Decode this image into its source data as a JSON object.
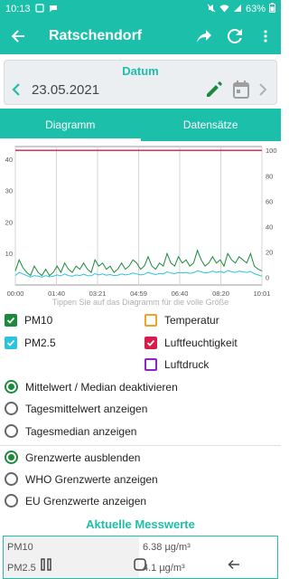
{
  "status": {
    "time": "10:13",
    "battery": "63%"
  },
  "appbar": {
    "title": "Ratschendorf"
  },
  "date_card": {
    "label": "Datum",
    "date": "23.05.2021"
  },
  "tabs": [
    {
      "label": "Diagramm"
    },
    {
      "label": "Datensätze"
    }
  ],
  "chart_data": {
    "type": "line",
    "x_ticks": [
      "00:00",
      "01:40",
      "03:21",
      "04:59",
      "06:40",
      "08:20",
      "10:01"
    ],
    "y_left_ticks": [
      "10",
      "20",
      "30",
      "40"
    ],
    "y_left_range": [
      0,
      44
    ],
    "y_right_ticks": [
      "0",
      "20",
      "40",
      "60",
      "80",
      "100"
    ],
    "y_right_range": [
      -6,
      103
    ],
    "series": [
      {
        "name": "PM10",
        "axis": "left",
        "color": "#1b8a3a",
        "values": [
          4.5,
          8,
          5.5,
          4,
          3,
          6,
          4,
          3,
          5,
          3,
          4,
          6,
          4,
          7,
          5,
          4,
          6,
          5,
          7,
          5,
          4,
          8,
          6,
          7,
          5,
          6,
          4,
          5,
          7,
          5,
          6,
          8,
          7,
          5,
          6,
          9,
          6,
          5,
          7,
          6,
          10,
          7,
          6,
          9,
          7,
          8,
          6,
          7,
          11,
          8,
          6,
          7,
          9,
          7,
          8,
          6,
          10,
          8,
          7,
          9,
          8,
          7,
          10,
          6,
          5,
          4.5
        ]
      },
      {
        "name": "PM2.5",
        "axis": "left",
        "color": "#29c4e0",
        "values": [
          3,
          4,
          3.5,
          3,
          2.5,
          3,
          2.8,
          2.5,
          3,
          2.6,
          2.8,
          3.2,
          2.9,
          3.5,
          3,
          2.8,
          3.2,
          3,
          3.4,
          3,
          2.9,
          3.6,
          3.2,
          3.5,
          3.1,
          3.3,
          3,
          3.1,
          3.5,
          3.2,
          3.4,
          3.8,
          3.5,
          3.2,
          3.4,
          4,
          3.6,
          3.3,
          3.7,
          3.5,
          4.2,
          3.8,
          3.6,
          4,
          3.8,
          4,
          3.7,
          3.9,
          4.5,
          4.2,
          3.8,
          4,
          4.4,
          4,
          4.3,
          3.9,
          4.6,
          4.2,
          4,
          4.4,
          4.2,
          4,
          4.3,
          3.6,
          3.2,
          2.8
        ]
      },
      {
        "name": "Luftfeuchtigkeit",
        "axis": "right",
        "color": "#d81b4a",
        "values": [
          100,
          100
        ]
      }
    ],
    "grid": true
  },
  "chart_hint": "Tippen Sie auf das Diagramm für die volle Größe",
  "legend": [
    {
      "label": "PM10",
      "checked": true,
      "color": "#1b8a3a"
    },
    {
      "label": "Temperatur",
      "checked": false,
      "color": "#f0a12a"
    },
    {
      "label": "PM2.5",
      "checked": true,
      "color": "#29c4e0"
    },
    {
      "label": "Luftfeuchtigkeit",
      "checked": true,
      "color": "#d81b4a"
    },
    {
      "label": "Luftdruck",
      "checked": false,
      "color": "#8e24c8"
    }
  ],
  "avg_options": [
    {
      "label": "Mittelwert / Median deaktivieren",
      "selected": true
    },
    {
      "label": "Tagesmittelwert anzeigen",
      "selected": false
    },
    {
      "label": "Tagesmedian anzeigen",
      "selected": false
    }
  ],
  "limit_options": [
    {
      "label": "Grenzwerte ausblenden",
      "selected": true
    },
    {
      "label": "WHO Grenzwerte anzeigen",
      "selected": false
    },
    {
      "label": "EU Grenzwerte anzeigen",
      "selected": false
    }
  ],
  "current": {
    "title": "Aktuelle Messwerte",
    "rows": [
      {
        "key": "PM10",
        "value": "6.38 µg/m³"
      },
      {
        "key": "PM2.5",
        "value": "4.1 µg/m³"
      }
    ]
  },
  "colors": {
    "accent": "#1cbfa9"
  }
}
